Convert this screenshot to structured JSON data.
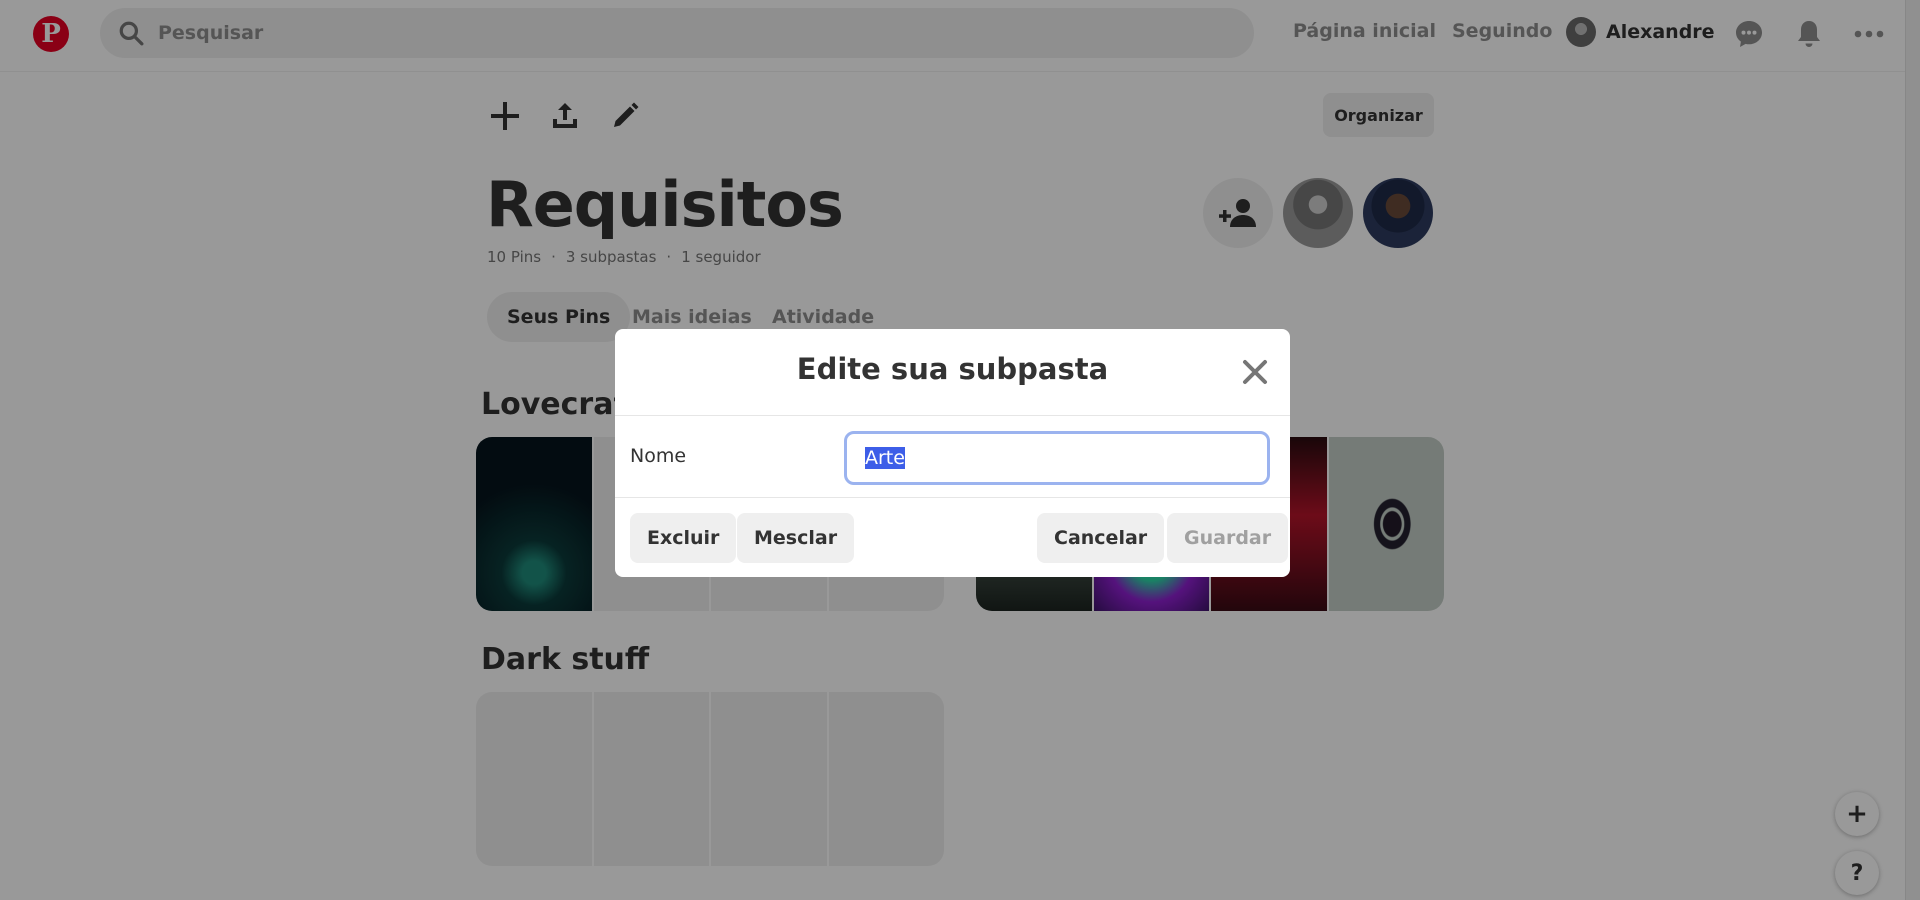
{
  "header": {
    "logo": "P",
    "search_placeholder": "Pesquisar",
    "nav_home": "Página inicial",
    "nav_following": "Seguindo",
    "user_name": "Alexandre",
    "icons": [
      "search-icon",
      "chat-icon",
      "bell-icon",
      "more-icon"
    ]
  },
  "board": {
    "title": "Requisitos",
    "stats": {
      "pins": "10 Pins",
      "sep1": "·",
      "subfolders": "3 subpastas",
      "sep2": "·",
      "followers": "1 seguidor"
    },
    "organize_label": "Organizar",
    "tabs": [
      {
        "label": "Seus Pins",
        "active": true
      },
      {
        "label": "Mais ideias",
        "active": false
      },
      {
        "label": "Atividade",
        "active": false
      }
    ],
    "sections": [
      {
        "title": "Lovecraft"
      },
      {
        "title": "Dark stuff"
      }
    ]
  },
  "floating": {
    "add": "+",
    "help": "?"
  },
  "modal": {
    "title": "Edite sua subpasta",
    "name_label": "Nome",
    "name_value": "Arte",
    "delete_label": "Excluir",
    "merge_label": "Mesclar",
    "cancel_label": "Cancelar",
    "save_label": "Guardar"
  },
  "colors": {
    "brand": "#e60023",
    "overlay": "rgba(0,0,0,0.4)",
    "selection": "#3d5ee8",
    "input_focus": "#9bb3ef"
  }
}
